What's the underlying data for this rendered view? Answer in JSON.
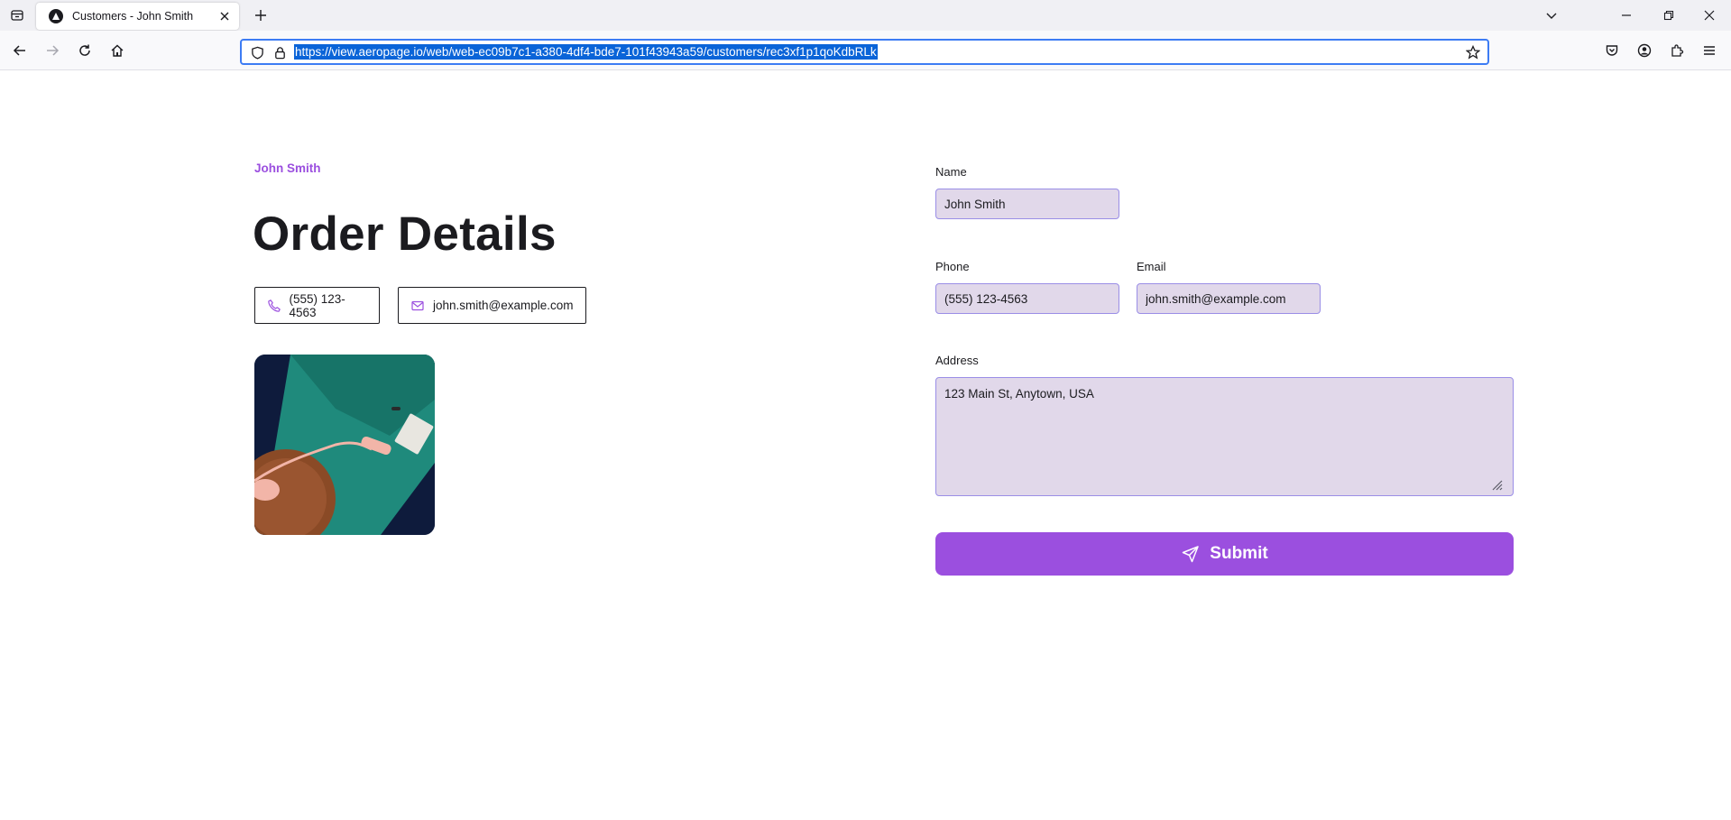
{
  "browser": {
    "tab_title": "Customers - John Smith",
    "url": "https://view.aeropage.io/web/web-ec09b7c1-a380-4df4-bde7-101f43943a59/customers/rec3xf1p1qoKdbRLk"
  },
  "header": {
    "breadcrumb": "John Smith",
    "title": "Order Details"
  },
  "contact": {
    "phone": "(555) 123-4563",
    "email": "john.smith@example.com"
  },
  "form": {
    "name_label": "Name",
    "name_value": "John Smith",
    "phone_label": "Phone",
    "phone_value": "(555) 123-4563",
    "email_label": "Email",
    "email_value": "john.smith@example.com",
    "address_label": "Address",
    "address_value": "123 Main St, Anytown, USA",
    "submit_label": "Submit"
  },
  "colors": {
    "accent": "#9b4fdf",
    "field_bg": "#e1d8ea",
    "field_border": "#9a8ee6"
  },
  "icons": {
    "phone": "phone-icon",
    "email": "mail-icon",
    "submit": "send-icon"
  }
}
